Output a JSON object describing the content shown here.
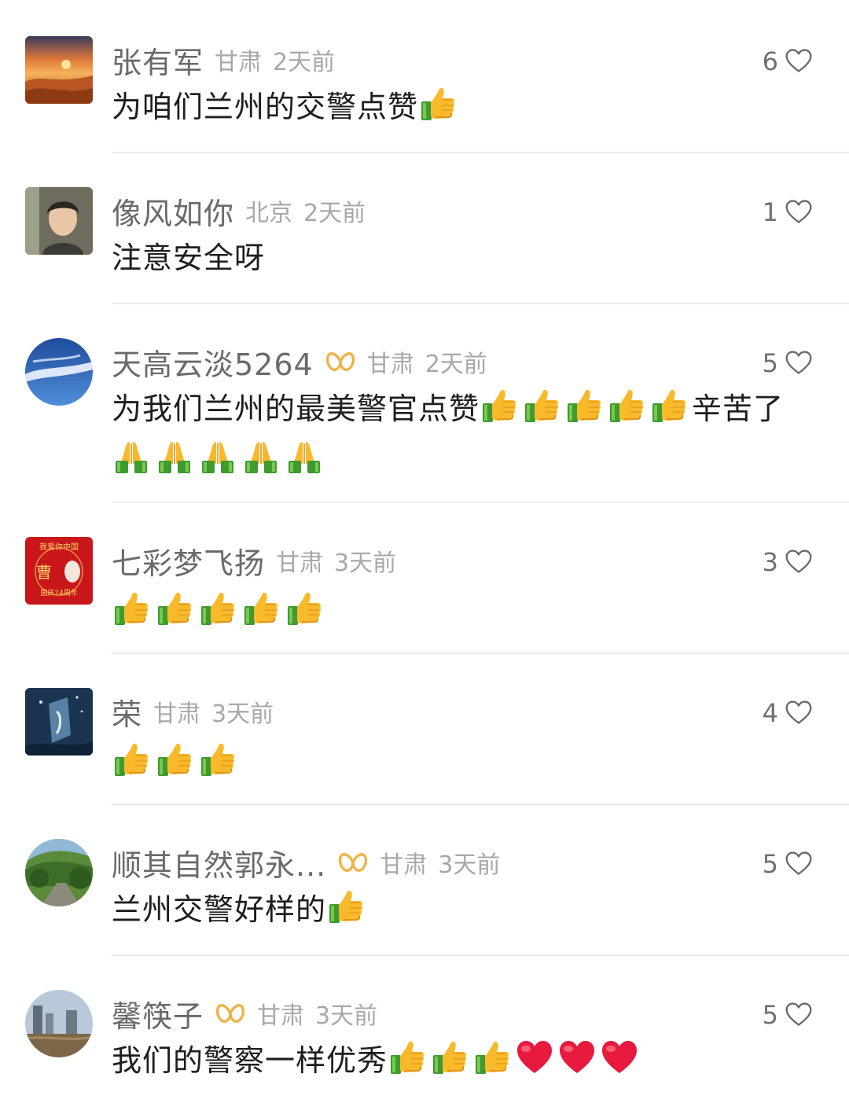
{
  "comments": [
    {
      "username": "张有军",
      "location": "甘肃",
      "time": "2天前",
      "likes": "6",
      "text": "为咱们兰州的交警点赞",
      "text_emojis": [
        "thumbs-up"
      ],
      "badge": false
    },
    {
      "username": "像风如你",
      "location": "北京",
      "time": "2天前",
      "likes": "1",
      "text": "注意安全呀",
      "text_emojis": [],
      "badge": false
    },
    {
      "username": "天高云淡5264",
      "location": "甘肃",
      "time": "2天前",
      "likes": "5",
      "text": "为我们兰州的最美警官点赞",
      "text_suffix": "辛苦了",
      "text_emojis": [
        "thumbs-up",
        "thumbs-up",
        "thumbs-up",
        "thumbs-up",
        "thumbs-up"
      ],
      "second_line_emojis": [
        "folded-hands",
        "folded-hands",
        "folded-hands",
        "folded-hands",
        "folded-hands"
      ],
      "badge": true
    },
    {
      "username": "七彩梦飞扬",
      "location": "甘肃",
      "time": "3天前",
      "likes": "3",
      "text": "",
      "text_emojis": [
        "thumbs-up",
        "thumbs-up",
        "thumbs-up",
        "thumbs-up",
        "thumbs-up"
      ],
      "badge": false,
      "avatar_text": {
        "top": "我爱你中国",
        "char": "曹",
        "bottom": "国庆74周年"
      }
    },
    {
      "username": "荣",
      "location": "甘肃",
      "time": "3天前",
      "likes": "4",
      "text": "",
      "text_emojis": [
        "thumbs-up",
        "thumbs-up",
        "thumbs-up"
      ],
      "badge": false
    },
    {
      "username": "顺其自然郭永...",
      "location": "甘肃",
      "time": "3天前",
      "likes": "5",
      "text": "兰州交警好样的",
      "text_emojis": [
        "thumbs-up"
      ],
      "badge": true
    },
    {
      "username": "馨筷子",
      "location": "甘肃",
      "time": "3天前",
      "likes": "5",
      "text": "我们的警察一样优秀",
      "text_emojis": [
        "thumbs-up",
        "thumbs-up",
        "thumbs-up",
        "red-heart",
        "red-heart",
        "red-heart"
      ],
      "badge": true
    }
  ],
  "icons": {
    "like": "heart-outline-icon",
    "badge": "infinity-badge-icon",
    "thumbs_up": "thumbs-up-emoji",
    "folded_hands": "folded-hands-emoji",
    "red_heart": "red-heart-emoji"
  },
  "colors": {
    "username": "#6a6a6a",
    "meta": "#a8a8a8",
    "text": "#1e1e1e",
    "badge": "#f0b24a",
    "divider": "#ececec"
  }
}
